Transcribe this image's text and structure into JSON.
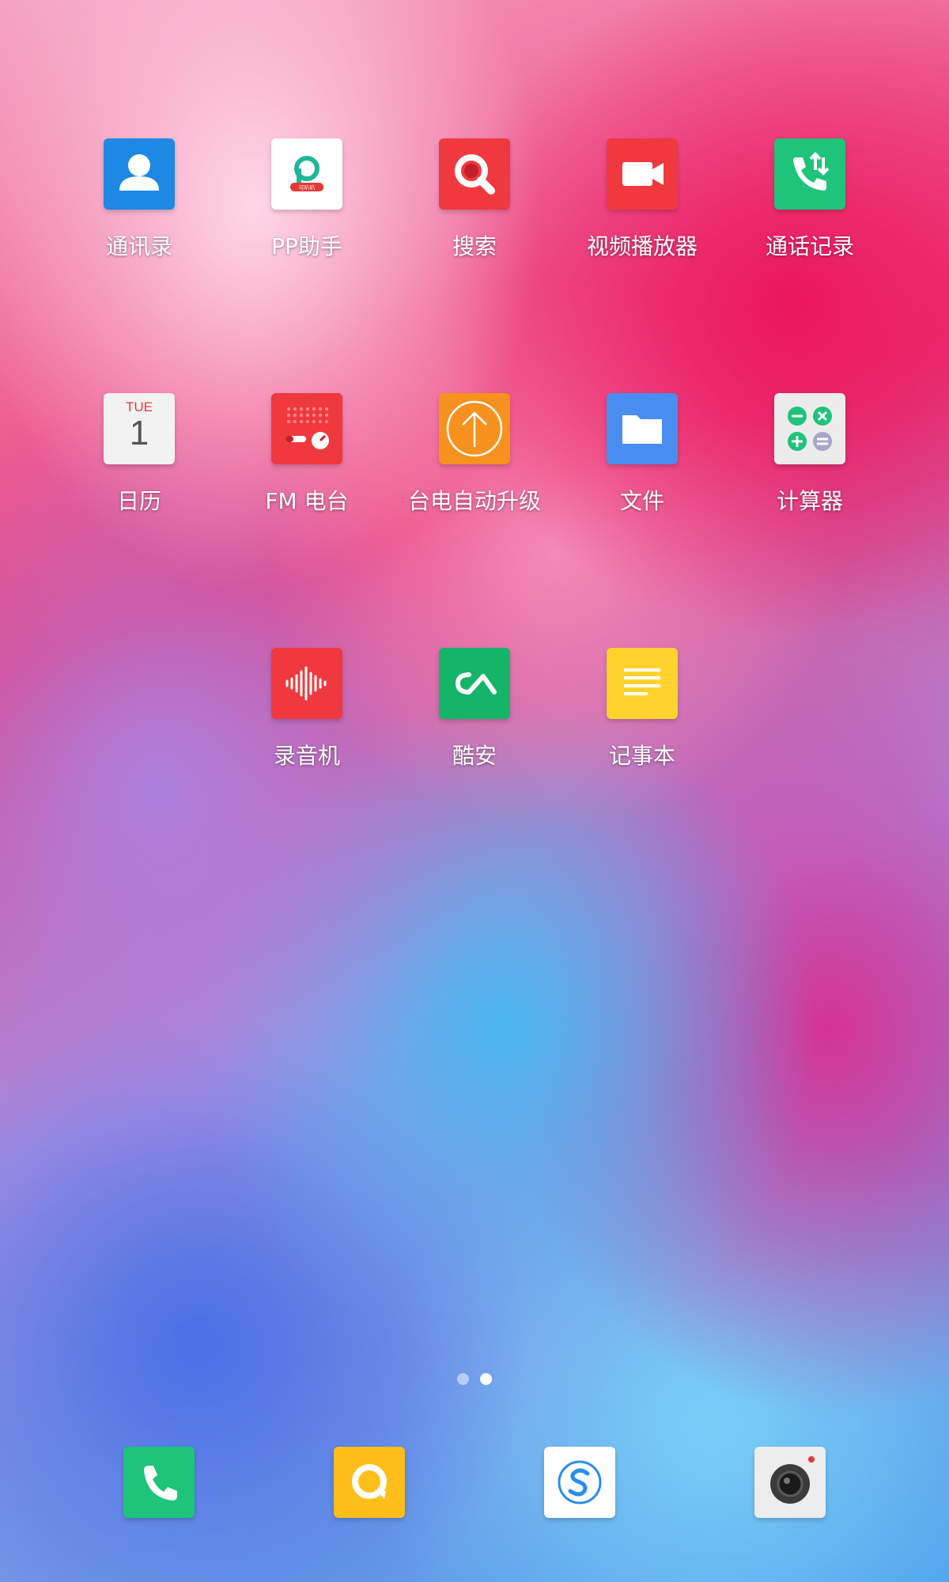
{
  "apps": [
    {
      "label": "通讯录",
      "icon": "contacts-icon",
      "color": "#1E88E5"
    },
    {
      "label": "PP助手",
      "icon": "pp-assistant-icon",
      "color": "#FFFFFF"
    },
    {
      "label": "搜索",
      "icon": "search-icon",
      "color": "#F0393F"
    },
    {
      "label": "视频播放器",
      "icon": "video-player-icon",
      "color": "#F0393F"
    },
    {
      "label": "通话记录",
      "icon": "call-log-icon",
      "color": "#1DC47A"
    },
    {
      "label": "日历",
      "icon": "calendar-icon",
      "color": "#F2F2F2",
      "day": "TUE",
      "date": "1"
    },
    {
      "label": "FM 电台",
      "icon": "fm-radio-icon",
      "color": "#F0393F"
    },
    {
      "label": "台电自动升级",
      "icon": "auto-update-icon",
      "color": "#F7921E"
    },
    {
      "label": "文件",
      "icon": "folder-icon",
      "color": "#4A8DF0"
    },
    {
      "label": "计算器",
      "icon": "calculator-icon",
      "color": "#ECECEC"
    },
    {
      "label": "录音机",
      "icon": "recorder-icon",
      "color": "#F0393F"
    },
    {
      "label": "酷安",
      "icon": "coolapk-icon",
      "color": "#14B569"
    },
    {
      "label": "记事本",
      "icon": "notepad-icon",
      "color": "#FFD32E"
    }
  ],
  "pp_badge_text": "可叭叭",
  "page_indicator": {
    "count": 2,
    "active": 2
  },
  "dock": [
    {
      "icon": "phone-icon",
      "color": "#1DC47A"
    },
    {
      "icon": "messages-icon",
      "color": "#FFBE1A"
    },
    {
      "icon": "browser-icon",
      "color": "#FFFFFF"
    },
    {
      "icon": "camera-icon",
      "color": "#EDEDED"
    }
  ]
}
